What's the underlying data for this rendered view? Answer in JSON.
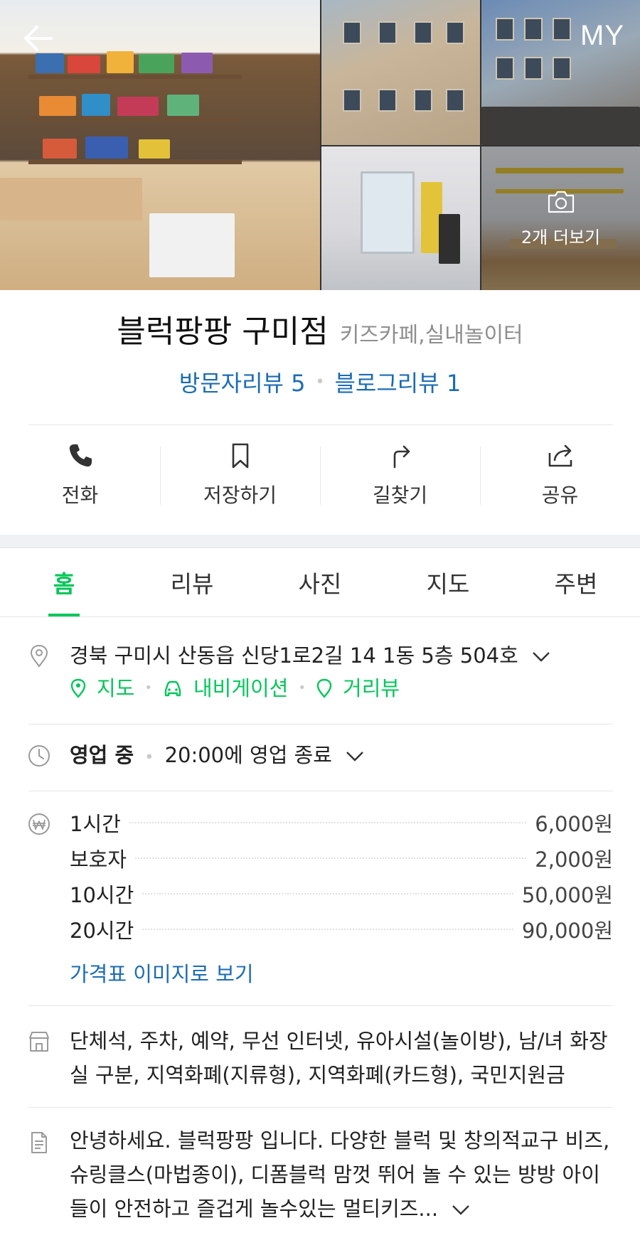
{
  "header": {
    "my_label": "MY"
  },
  "photos": {
    "more_label": "2개 더보기"
  },
  "place": {
    "name": "블럭팡팡 구미점",
    "category": "키즈카페,실내놀이터",
    "visitor_reviews": "방문자리뷰 5",
    "blog_reviews": "블로그리뷰 1"
  },
  "actions": [
    {
      "label": "전화",
      "icon": "phone-icon"
    },
    {
      "label": "저장하기",
      "icon": "bookmark-icon"
    },
    {
      "label": "길찾기",
      "icon": "directions-icon"
    },
    {
      "label": "공유",
      "icon": "share-icon"
    }
  ],
  "tabs": [
    {
      "label": "홈",
      "active": true
    },
    {
      "label": "리뷰",
      "active": false
    },
    {
      "label": "사진",
      "active": false
    },
    {
      "label": "지도",
      "active": false
    },
    {
      "label": "주변",
      "active": false
    }
  ],
  "address": {
    "text": "경북 구미시 산동읍 신당1로2길 14 1동 5층 504호",
    "links": [
      "지도",
      "내비게이션",
      "거리뷰"
    ]
  },
  "hours": {
    "status": "영업 중",
    "detail": "20:00에 영업 종료"
  },
  "prices": {
    "items": [
      {
        "label": "1시간",
        "value": "6,000원"
      },
      {
        "label": "보호자",
        "value": "2,000원"
      },
      {
        "label": "10시간",
        "value": "50,000원"
      },
      {
        "label": "20시간",
        "value": "90,000원"
      }
    ],
    "image_link": "가격표 이미지로 보기"
  },
  "facilities": {
    "text": "단체석, 주차, 예약, 무선 인터넷, 유아시설(놀이방), 남/녀 화장실 구분, 지역화폐(지류형), 지역화폐(카드형), 국민지원금"
  },
  "description": {
    "text": "안녕하세요. 블럭팡팡 입니다. 다양한 블럭 및 창의적교구 비즈, 슈링클스(마법종이), 디폼블럭 맘껏 뛰어 놀 수 있는 방방 아이들이 안전하고 즐겁게 놀수있는 멀티키즈..."
  },
  "colors": {
    "accent": "#03c75a",
    "link": "#1c6cb3"
  }
}
